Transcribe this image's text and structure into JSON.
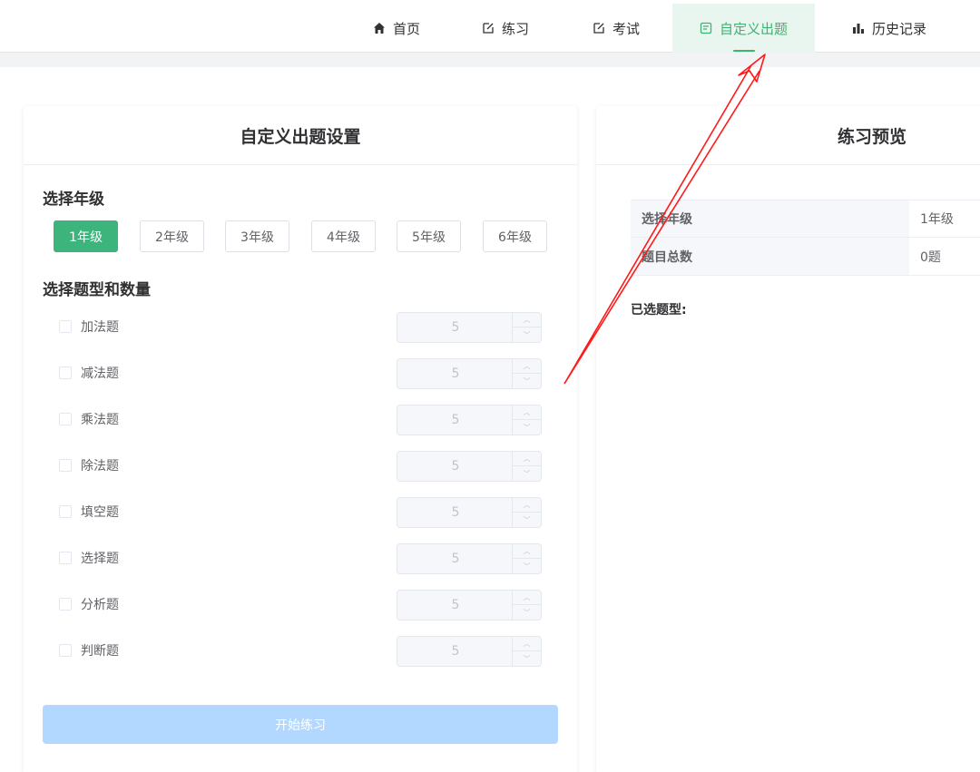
{
  "nav": {
    "items": [
      {
        "label": "首页",
        "icon": "home-icon"
      },
      {
        "label": "练习",
        "icon": "edit-icon"
      },
      {
        "label": "考试",
        "icon": "edit-icon"
      },
      {
        "label": "自定义出题",
        "icon": "document-icon"
      },
      {
        "label": "历史记录",
        "icon": "bar-chart-icon"
      }
    ],
    "active_index": 3,
    "accent_color": "#3cb371"
  },
  "settings": {
    "title": "自定义出题设置",
    "grade_title": "选择年级",
    "grades": [
      "1年级",
      "2年级",
      "3年级",
      "4年级",
      "5年级",
      "6年级"
    ],
    "selected_grade": "1年级",
    "types_title": "选择题型和数量",
    "types": [
      {
        "label": "加法题",
        "value": "5"
      },
      {
        "label": "减法题",
        "value": "5"
      },
      {
        "label": "乘法题",
        "value": "5"
      },
      {
        "label": "除法题",
        "value": "5"
      },
      {
        "label": "填空题",
        "value": "5"
      },
      {
        "label": "选择题",
        "value": "5"
      },
      {
        "label": "分析题",
        "value": "5"
      },
      {
        "label": "判断题",
        "value": "5"
      }
    ],
    "start_label": "开始练习"
  },
  "preview": {
    "title": "练习预览",
    "rows": [
      {
        "key": "选择年级",
        "value": "1年级"
      },
      {
        "key": "题目总数",
        "value": "0题"
      }
    ],
    "selected_types_label": "已选题型:"
  }
}
